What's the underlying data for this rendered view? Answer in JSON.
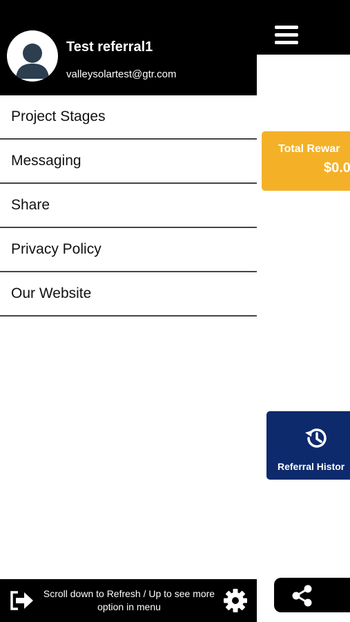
{
  "drawer": {
    "user": {
      "name": "Test referral1",
      "email": "valleysolartest@gtr.com"
    },
    "menu_items": [
      {
        "label": "Project Stages"
      },
      {
        "label": "Messaging"
      },
      {
        "label": "Share"
      },
      {
        "label": "Privacy Policy"
      },
      {
        "label": "Our Website"
      }
    ],
    "footer": {
      "hint_line1": "Scroll down to Refresh / Up to see more",
      "hint_line2": "option in menu"
    }
  },
  "background": {
    "reward_card": {
      "title": "Total Rewar",
      "value": "$0.0",
      "color": "#F4B127"
    },
    "history_card": {
      "label": "Referral Histor",
      "color": "#0D2A6C"
    }
  },
  "icons": [
    "menu-icon",
    "avatar-icon",
    "history-icon",
    "share-icon",
    "logout-icon",
    "settings-icon"
  ]
}
